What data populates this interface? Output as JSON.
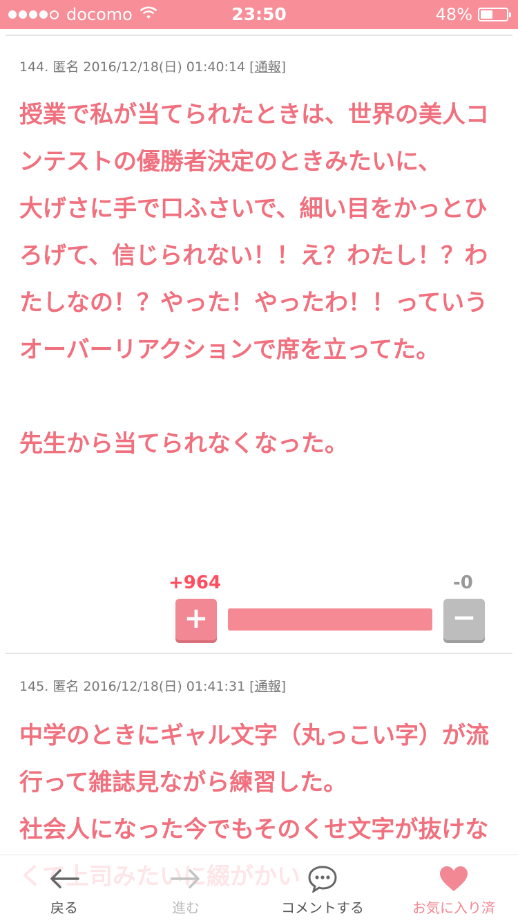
{
  "status_bar": {
    "carrier": "docomo",
    "time": "23:50",
    "battery": "48%",
    "battery_level": 0.48
  },
  "posts": [
    {
      "number": "144.",
      "author": "匿名",
      "datetime": "2016/12/18(日) 01:40:14",
      "report_label": "通報",
      "body": "授業で私が当てられたときは、世界の美人コンテストの優勝者決定のときみたいに、\n大げさに手で口ふさいで、細い目をかっとひろげて、信じられない！！え？わたし！？わたしなの！？やった！やったわ！！っていうオーバーリアクションで席を立ってた。\n\n先生から当てられなくなった。",
      "plus_votes": "+964",
      "minus_votes": "-0",
      "plus_icon": "+",
      "minus_icon": "−",
      "plus_ratio": 1.0
    },
    {
      "number": "145.",
      "author": "匿名",
      "datetime": "2016/12/18(日) 01:41:31",
      "report_label": "通報",
      "body": "中学のときにギャル文字（丸っこい字）が流行って雑誌見ながら練習した。\n社会人になった今でもそのくせ文字が抜けなくて上司みたいに綴がかい"
    }
  ],
  "tab_bar": {
    "back": "戻る",
    "forward": "進む",
    "comment": "コメントする",
    "favorite": "お気に入り済"
  },
  "colors": {
    "accent": "#f78e98",
    "body_text": "#f0707e",
    "plus_count": "#ff4d5e",
    "minus_button": "#bdbdbd"
  },
  "icons": {
    "back": "arrow-left-icon",
    "forward": "arrow-right-icon",
    "comment": "speech-bubble-icon",
    "favorite": "heart-icon"
  }
}
